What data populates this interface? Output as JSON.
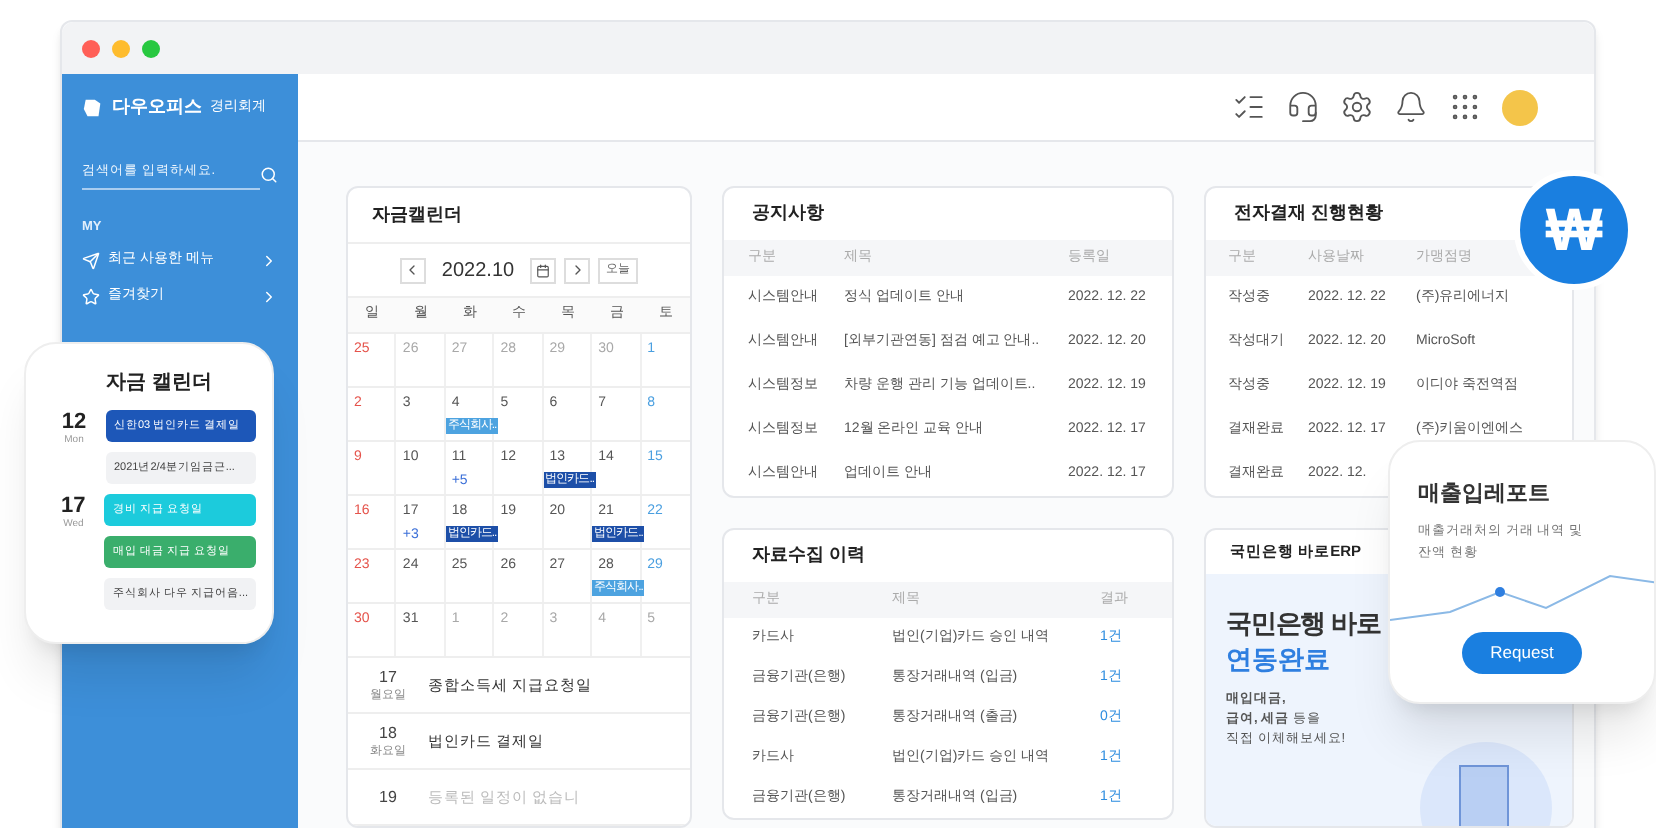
{
  "sidebar": {
    "brand": "다우오피스",
    "product": "경리회계",
    "search": {
      "placeholder": "검색어를 입력하세요."
    },
    "section": "MY",
    "items": [
      {
        "kind": "recent",
        "label": "최근 사용한 메뉴"
      },
      {
        "kind": "favorite",
        "label": "즐겨찾기"
      }
    ]
  },
  "calendar": {
    "title": "자금캘린더",
    "month": "2022.10",
    "today": "오늘",
    "weekdays": [
      "일",
      "월",
      "화",
      "수",
      "목",
      "금",
      "토"
    ],
    "weeks": [
      [
        {
          "day": "25",
          "muted": false
        },
        {
          "day": "26",
          "muted": true
        },
        {
          "day": "27",
          "muted": true
        },
        {
          "day": "28",
          "muted": true
        },
        {
          "day": "29",
          "muted": true
        },
        {
          "day": "30",
          "muted": true
        },
        {
          "day": "1",
          "muted": false
        }
      ],
      [
        {
          "day": "2",
          "muted": false
        },
        {
          "day": "3",
          "muted": false
        },
        {
          "day": "4",
          "muted": false,
          "events": [
            {
              "label": "주식회사..",
              "color": "#4da3e0"
            }
          ]
        },
        {
          "day": "5",
          "muted": false
        },
        {
          "day": "6",
          "muted": false
        },
        {
          "day": "7",
          "muted": false
        },
        {
          "day": "8",
          "muted": false
        }
      ],
      [
        {
          "day": "9",
          "muted": false
        },
        {
          "day": "10",
          "muted": false
        },
        {
          "day": "11",
          "muted": false,
          "more": "+5"
        },
        {
          "day": "12",
          "muted": false
        },
        {
          "day": "13",
          "muted": false,
          "events": [
            {
              "label": "법인카드..",
              "color": "#1d4fa8"
            }
          ]
        },
        {
          "day": "14",
          "muted": false
        },
        {
          "day": "15",
          "muted": false
        }
      ],
      [
        {
          "day": "16",
          "muted": false
        },
        {
          "day": "17",
          "muted": false,
          "more": "+3"
        },
        {
          "day": "18",
          "muted": false,
          "events": [
            {
              "label": "법인카드..",
              "color": "#1d4fa8"
            }
          ]
        },
        {
          "day": "19",
          "muted": false
        },
        {
          "day": "20",
          "muted": false
        },
        {
          "day": "21",
          "muted": false,
          "events": [
            {
              "label": "법인카드..",
              "color": "#1d4fa8"
            }
          ]
        },
        {
          "day": "22",
          "muted": false
        }
      ],
      [
        {
          "day": "23",
          "muted": false
        },
        {
          "day": "24",
          "muted": false
        },
        {
          "day": "25",
          "muted": false
        },
        {
          "day": "26",
          "muted": false
        },
        {
          "day": "27",
          "muted": false
        },
        {
          "day": "28",
          "muted": false,
          "events": [
            {
              "label": "주식회사..",
              "color": "#4da3e0"
            }
          ]
        },
        {
          "day": "29",
          "muted": false
        }
      ],
      [
        {
          "day": "30",
          "muted": false
        },
        {
          "day": "31",
          "muted": false
        },
        {
          "day": "1",
          "muted": true
        },
        {
          "day": "2",
          "muted": true
        },
        {
          "day": "3",
          "muted": true
        },
        {
          "day": "4",
          "muted": true
        },
        {
          "day": "5",
          "muted": true
        }
      ]
    ],
    "agenda": [
      {
        "day": "17",
        "weekday": "월요일",
        "title": "종합소득세 지급요청일",
        "empty": false
      },
      {
        "day": "18",
        "weekday": "화요일",
        "title": "법인카드 결제일",
        "empty": false
      },
      {
        "day": "19",
        "title": "등록된 일정이 없습니",
        "empty": true
      }
    ]
  },
  "notices": {
    "title": "공지사항",
    "columns": [
      {
        "label": "구분"
      },
      {
        "label": "제목"
      },
      {
        "label": "등록일"
      }
    ],
    "rows": [
      [
        "시스템안내",
        "정식 업데이트 안내",
        "2022. 12. 22"
      ],
      [
        "시스템안내",
        "[외부기관연동] 점검 예고 안내..",
        "2022. 12. 20"
      ],
      [
        "시스템정보",
        "차량 운행 관리 기능 업데이트..",
        "2022. 12. 19"
      ],
      [
        "시스템정보",
        "12월 온라인 교육 안내",
        "2022. 12. 17"
      ],
      [
        "시스템안내",
        "업데이트 안내",
        "2022. 12. 17"
      ]
    ]
  },
  "collection": {
    "title": "자료수집 이력",
    "columns": [
      {
        "label": "구분",
        "kind": "text"
      },
      {
        "label": "제목",
        "kind": "text"
      },
      {
        "label": "결과",
        "kind": "count"
      }
    ],
    "rows": [
      [
        "카드사",
        "법인(기업)카드 승인 내역",
        "1건"
      ],
      [
        "금융기관(은행)",
        "통장거래내역 (입금)",
        "1건"
      ],
      [
        "금융기관(은행)",
        "통장거래내역 (출금)",
        "0건"
      ],
      [
        "카드사",
        "법인(기업)카드 승인 내역",
        "1건"
      ],
      [
        "금융기관(은행)",
        "통장거래내역 (입금)",
        "1건"
      ]
    ]
  },
  "approval": {
    "title": "전자결재 진행현황",
    "columns": [
      {
        "label": "구분"
      },
      {
        "label": "사용날짜"
      },
      {
        "label": "가맹점명"
      }
    ],
    "rows": [
      [
        "작성중",
        "2022. 12. 22",
        "(주)유리에너지"
      ],
      [
        "작성대기",
        "2022. 12. 20",
        "MicroSoft"
      ],
      [
        "작성중",
        "2022. 12. 19",
        "이디야 죽전역점"
      ],
      [
        "결재완료",
        "2022. 12. 17",
        "(주)키움이엔에스"
      ],
      [
        "결재완료",
        "2022. 12."
      ]
    ]
  },
  "bank": {
    "title": "국민은행 바로ERP",
    "headline": "국민은행 바로",
    "status": "연동완료",
    "lines": [
      "**매입대금,**",
      "**급여, 세금** 등을",
      "직접 이체해보세요!"
    ]
  },
  "badge": {
    "symbol": "₩"
  },
  "report": {
    "title": "매출입레포트",
    "description": "매출거래처의 거래 내역 및 잔액 현황",
    "button": "Request"
  },
  "fund_card": {
    "title": "자금 캘린더",
    "groups": [
      {
        "date": "12",
        "weekday": "Mon",
        "items": [
          {
            "label": "신한03 법인카드 결제일",
            "color": "#1d57b8"
          },
          {
            "label": "2021년2/4분기임금근...",
            "color": "#f1f2f4"
          }
        ]
      },
      {
        "date": "17",
        "weekday": "Wed",
        "items": [
          {
            "label": "경비 지급 요청일",
            "color": "#1ccbdc"
          },
          {
            "label": "매입 대금 지급 요청일",
            "color": "#3aae6c"
          },
          {
            "label": "주식회사 다우 지급어음...",
            "color": "#f1f2f4"
          }
        ]
      }
    ]
  }
}
